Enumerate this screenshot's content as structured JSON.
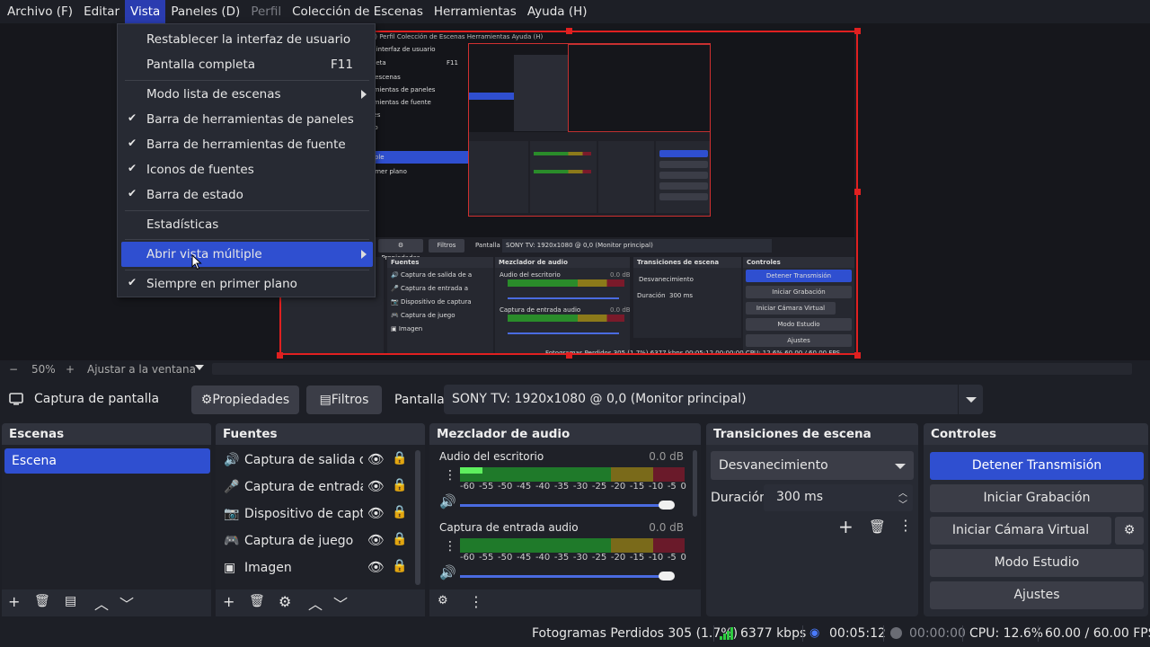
{
  "menubar": {
    "items": [
      "Archivo (F)",
      "Editar",
      "Vista",
      "Paneles (D)",
      "Perfil",
      "Colección de Escenas",
      "Herramientas",
      "Ayuda (H)"
    ]
  },
  "view_menu": {
    "reset_ui": "Restablecer la interfaz de usuario",
    "fullscreen": "Pantalla completa",
    "fullscreen_shortcut": "F11",
    "scene_list_mode": "Modo lista de escenas",
    "dock_toolbars": "Barra de herramientas de paneles",
    "source_toolbar": "Barra de herramientas de fuente",
    "source_icons": "Iconos de fuentes",
    "status_bar": "Barra de estado",
    "stats": "Estadísticas",
    "multiview": "Abrir vista múltiple",
    "always_on_top": "Siempre en primer plano"
  },
  "zoom": {
    "minus": "−",
    "level": "50%",
    "plus": "+",
    "fit": "Ajustar a la ventana"
  },
  "source_toolbar": {
    "source_name": "Captura de pantalla",
    "properties": "Propiedades",
    "filters": "Filtros",
    "display_label": "Pantalla",
    "display_value": "SONY TV: 1920x1080 @ 0,0 (Monitor principal)"
  },
  "scenes": {
    "title": "Escenas",
    "items": [
      "Escena"
    ]
  },
  "sources": {
    "title": "Fuentes",
    "items": [
      {
        "label": "Captura de salida de audio",
        "icon": "speaker-icon"
      },
      {
        "label": "Captura de entrada audio",
        "icon": "microphone-icon"
      },
      {
        "label": "Dispositivo de captura",
        "icon": "camera-icon"
      },
      {
        "label": "Captura de juego",
        "icon": "gamepad-icon"
      },
      {
        "label": "Imagen",
        "icon": "image-icon"
      }
    ]
  },
  "mixer": {
    "title": "Mezclador de audio",
    "scale": [
      "-60",
      "-55",
      "-50",
      "-45",
      "-40",
      "-35",
      "-30",
      "-25",
      "-20",
      "-15",
      "-10",
      "-5",
      "0"
    ],
    "channels": [
      {
        "name": "Audio del escritorio",
        "db": "0.0 dB",
        "level": 0.1,
        "volume": 1.0
      },
      {
        "name": "Captura de entrada audio",
        "db": "0.0 dB",
        "level": 0.0,
        "volume": 1.0
      }
    ]
  },
  "transitions": {
    "title": "Transiciones de escena",
    "type": "Desvanecimiento",
    "duration_label": "Duración",
    "duration_value": "300 ms"
  },
  "controls": {
    "title": "Controles",
    "stop_stream": "Detener Transmisión",
    "start_recording": "Iniciar Grabación",
    "start_virtual_cam": "Iniciar Cámara Virtual",
    "studio_mode": "Modo Estudio",
    "settings": "Ajustes"
  },
  "status": {
    "dropped_frames": "Fotogramas Perdidos 305 (1.7%)",
    "bitrate": "6377 kbps",
    "stream_time": "00:05:12",
    "rec_time": "00:00:00",
    "cpu": "CPU: 12.6%",
    "fps": "60.00 / 60.00 FPS"
  },
  "colors": {
    "accent": "#2f4fd0",
    "selection_border": "#e02020",
    "live_green": "#2ecc40"
  }
}
